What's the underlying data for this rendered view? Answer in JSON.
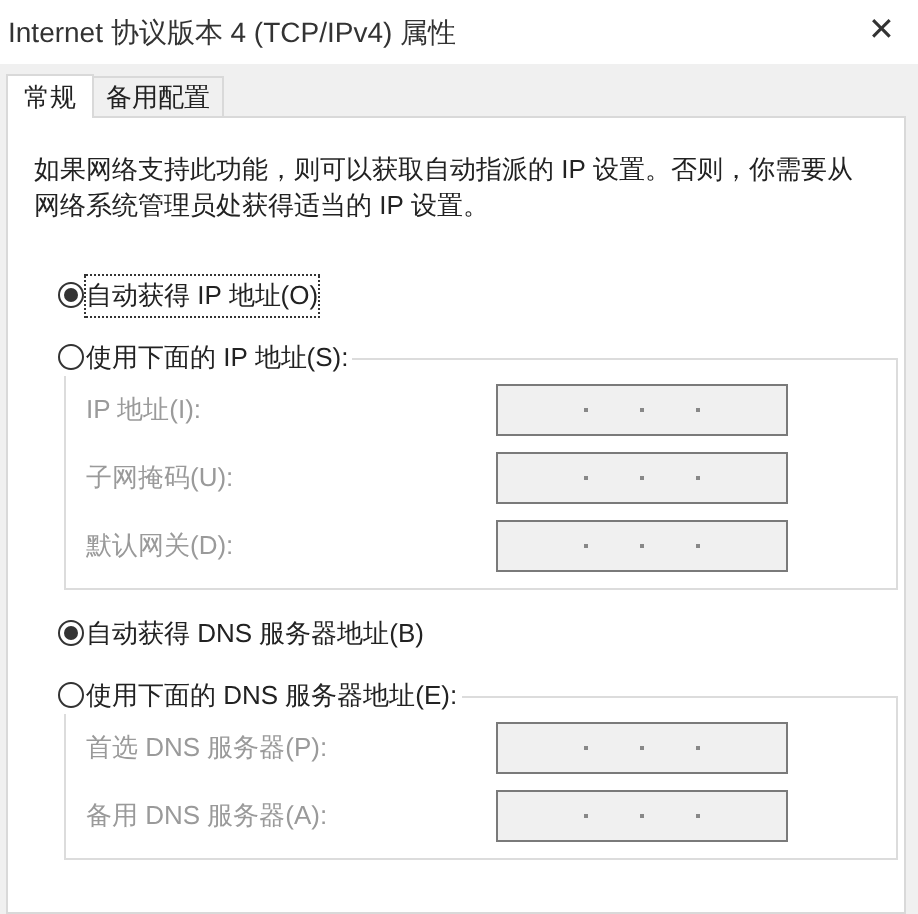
{
  "window": {
    "title": "Internet 协议版本 4 (TCP/IPv4) 属性",
    "close": "✕"
  },
  "tabs": [
    {
      "label": "常规",
      "selected": true
    },
    {
      "label": "备用配置",
      "selected": false
    }
  ],
  "description": "如果网络支持此功能，则可以获取自动指派的 IP 设置。否则，你需要从网络系统管理员处获得适当的 IP 设置。",
  "ip": {
    "options": [
      {
        "label": "自动获得 IP 地址(O)",
        "selected": true,
        "focused": true
      },
      {
        "label": "使用下面的 IP 地址(S):",
        "selected": false,
        "focused": false
      }
    ],
    "fields": [
      {
        "label": "IP 地址(I):",
        "disabled": true
      },
      {
        "label": "子网掩码(U):",
        "disabled": true
      },
      {
        "label": "默认网关(D):",
        "disabled": true
      }
    ]
  },
  "dns": {
    "options": [
      {
        "label": "自动获得 DNS 服务器地址(B)",
        "selected": true,
        "focused": false
      },
      {
        "label": "使用下面的 DNS 服务器地址(E):",
        "selected": false,
        "focused": false
      }
    ],
    "fields": [
      {
        "label": "首选 DNS 服务器(P):",
        "disabled": true
      },
      {
        "label": "备用 DNS 服务器(A):",
        "disabled": true
      }
    ]
  }
}
